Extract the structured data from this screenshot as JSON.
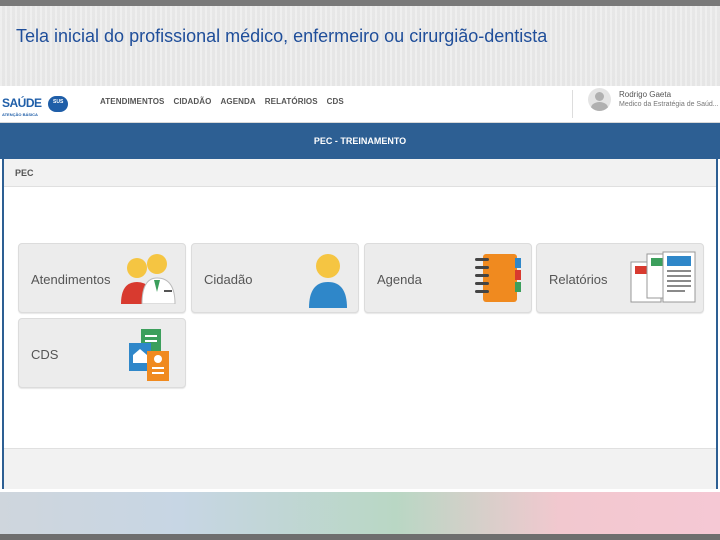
{
  "slide": {
    "title": "Tela inicial do profissional médico, enfermeiro ou cirurgião-dentista"
  },
  "header": {
    "logo_text": "SAÚDE",
    "logo_badge": "SUS",
    "logo_subtitle": "ATENÇÃO BÁSICA",
    "nav": [
      "ATENDIMENTOS",
      "CIDADÃO",
      "AGENDA",
      "RELATÓRIOS",
      "CDS"
    ],
    "user": {
      "name": "Rodrigo Gaeta",
      "role": "Medico da Estratégia de Saúd..."
    }
  },
  "env_bar": {
    "label": "PEC - TREINAMENTO"
  },
  "panel": {
    "title": "PEC",
    "tiles": [
      {
        "label": "Atendimentos",
        "icon": "people-icon"
      },
      {
        "label": "Cidadão",
        "icon": "person-icon"
      },
      {
        "label": "Agenda",
        "icon": "notebook-icon"
      },
      {
        "label": "Relatórios",
        "icon": "reports-icon"
      },
      {
        "label": "CDS",
        "icon": "forms-icon"
      }
    ]
  },
  "colors": {
    "title_blue": "#1f4e9a",
    "header_blue": "#2d5f93",
    "tile_bg": "#ececec"
  }
}
